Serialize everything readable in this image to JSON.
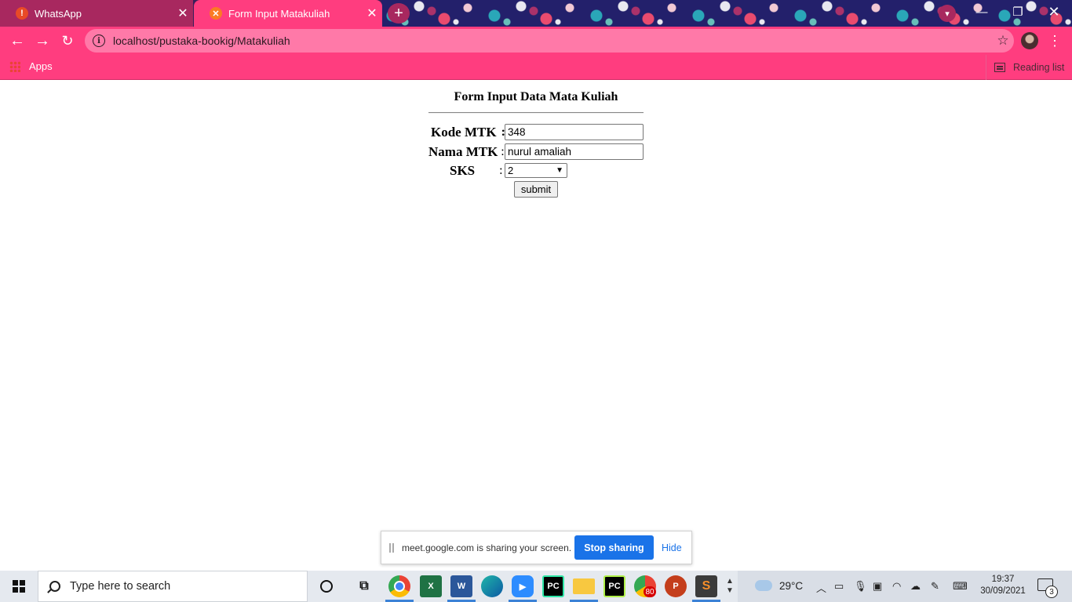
{
  "browser": {
    "tabs": [
      {
        "title": "WhatsApp",
        "favicon": "!",
        "close": "✕"
      },
      {
        "title": "Form Input Matakuliah",
        "favicon": "✕",
        "close": "✕"
      }
    ],
    "new_tab": "+",
    "window_controls": {
      "minimize": "—",
      "maximize": "❐",
      "close": "✕"
    },
    "url": "localhost/pustaka-bookig/Matakuliah",
    "bookmarks": {
      "apps_label": "Apps",
      "reading_list_label": "Reading list"
    }
  },
  "form": {
    "title": "Form Input Data Mata Kuliah",
    "fields": {
      "kode": {
        "label": "Kode MTK",
        "colon": ":",
        "value": "348"
      },
      "nama": {
        "label": "Nama MTK",
        "colon": ":",
        "value": "nurul amaliah"
      },
      "sks": {
        "label": "SKS",
        "colon": ":",
        "selected": "2"
      }
    },
    "submit_label": "submit"
  },
  "sharing_bar": {
    "message": "meet.google.com is sharing your screen.",
    "stop_label": "Stop sharing",
    "hide_label": "Hide"
  },
  "taskbar": {
    "search_placeholder": "Type here to search",
    "apps": [
      {
        "name": "chrome-icon"
      },
      {
        "name": "excel-icon",
        "glyph": "X"
      },
      {
        "name": "word-icon",
        "glyph": "W"
      },
      {
        "name": "edge-icon"
      },
      {
        "name": "zoom-icon"
      },
      {
        "name": "pycharm-icon",
        "glyph": "PC"
      },
      {
        "name": "file-explorer-icon"
      },
      {
        "name": "pycharm-run-icon",
        "glyph": "PC"
      },
      {
        "name": "chrome-profile-icon",
        "badge": "80"
      },
      {
        "name": "powerpoint-icon",
        "glyph": "P"
      },
      {
        "name": "sublime-text-icon",
        "glyph": "S"
      }
    ],
    "weather": {
      "temperature": "29°C"
    },
    "clock": {
      "time": "19:37",
      "date": "30/09/2021"
    },
    "notification_count": "3"
  }
}
